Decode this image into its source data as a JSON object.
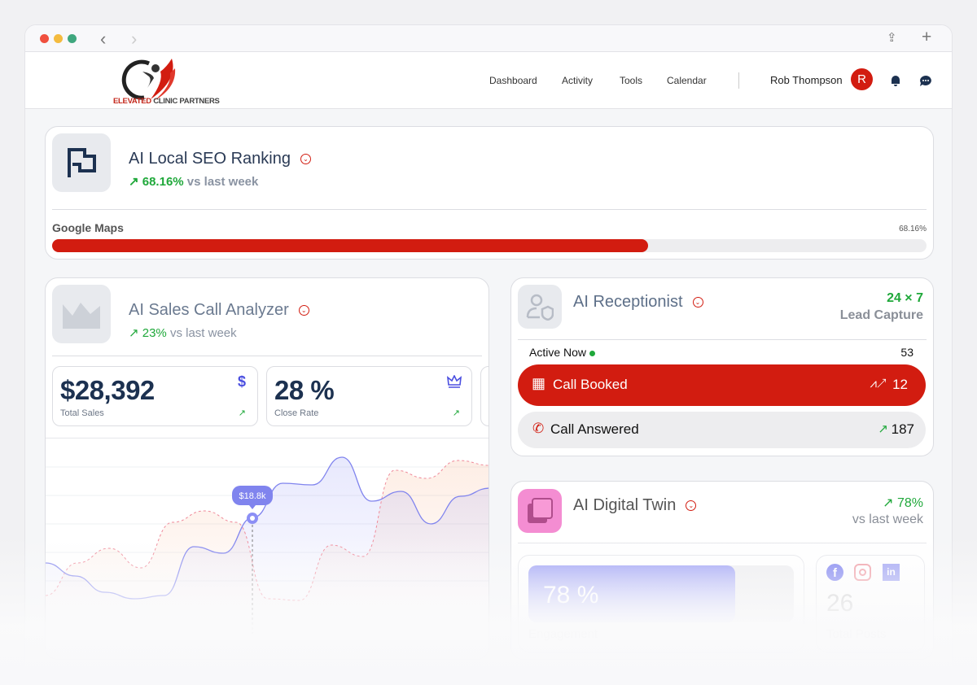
{
  "browser": {
    "back": "‹",
    "forward": "›",
    "share": "⇪",
    "new_tab": "+"
  },
  "brand": {
    "name_red": "ELEVATED",
    "name_dark": "CLINIC PARTNERS"
  },
  "nav": {
    "items": [
      "Dashboard",
      "Activity",
      "Tools",
      "Calendar"
    ],
    "user": "Rob Thompson",
    "avatar_initial": "R"
  },
  "colors": {
    "accent": "#d21c10",
    "positive": "#1fa83a",
    "purple": "#7b7ff0"
  },
  "seo": {
    "title": "AI Local SEO Ranking",
    "change": "68.16%",
    "change_suffix": "vs last week",
    "bar_label": "Google Maps",
    "bar_value_label": "68.16%",
    "progress": 68.16
  },
  "sales": {
    "title": "AI Sales Call Analyzer",
    "change": "23%",
    "change_suffix": "vs last week",
    "stats": [
      {
        "value": "$28,392",
        "label": "Total Sales",
        "icon": "dollar-icon"
      },
      {
        "value": "28 %",
        "label": "Close Rate",
        "icon": "crown-icon"
      }
    ],
    "tooltip": "$18.8k",
    "chart": {
      "solid": [
        40,
        32,
        22,
        18,
        20,
        50,
        46,
        68,
        89,
        88,
        105,
        78,
        84,
        64,
        81,
        86
      ],
      "dashed": [
        20,
        40,
        49,
        37,
        65,
        72,
        65,
        18,
        17,
        51,
        44,
        97,
        92,
        103,
        100
      ]
    }
  },
  "receptionist": {
    "title": "AI Receptionist",
    "badge": "24 × 7",
    "badge_sub": "Lead Capture",
    "active_label": "Active Now",
    "active_count": "53",
    "booked_label": "Call Booked",
    "booked_count": "12",
    "answered_label": "Call Answered",
    "answered_count": "187"
  },
  "twin": {
    "title": "AI Digital Twin",
    "change": "78%",
    "change_suffix": "vs last week",
    "engagement_value": "78 %",
    "engagement_label": "Engagement",
    "engagement": 78,
    "posts_value": "26",
    "posts_label": "Total Posts"
  }
}
